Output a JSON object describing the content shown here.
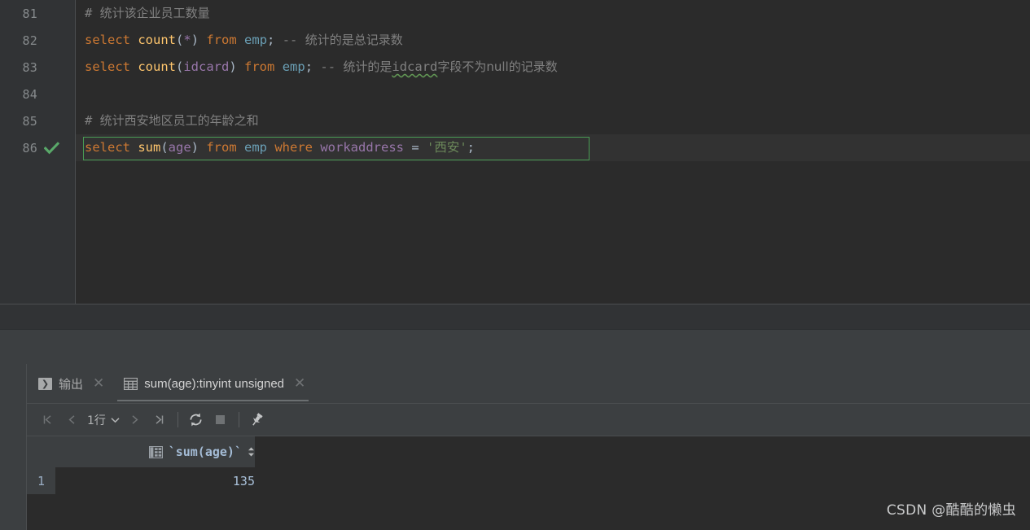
{
  "editor": {
    "lines": [
      {
        "number": "81",
        "has_check": false,
        "selected": false,
        "segments": [
          {
            "text": "# ",
            "type": "comment"
          },
          {
            "text": "统计该企业员工数量",
            "type": "comment-zh"
          }
        ]
      },
      {
        "number": "82",
        "has_check": false,
        "selected": false,
        "segments": [
          {
            "text": "select ",
            "type": "keyword"
          },
          {
            "text": "count",
            "type": "function"
          },
          {
            "text": "(",
            "type": "punct"
          },
          {
            "text": "*",
            "type": "ident"
          },
          {
            "text": ") ",
            "type": "punct"
          },
          {
            "text": "from ",
            "type": "keyword"
          },
          {
            "text": "emp",
            "type": "table"
          },
          {
            "text": "; ",
            "type": "punct"
          },
          {
            "text": "-- ",
            "type": "comment"
          },
          {
            "text": "统计的是总记录数",
            "type": "comment-zh"
          }
        ]
      },
      {
        "number": "83",
        "has_check": false,
        "selected": false,
        "segments": [
          {
            "text": "select ",
            "type": "keyword"
          },
          {
            "text": "count",
            "type": "function"
          },
          {
            "text": "(",
            "type": "punct"
          },
          {
            "text": "idcard",
            "type": "ident"
          },
          {
            "text": ") ",
            "type": "punct"
          },
          {
            "text": "from ",
            "type": "keyword"
          },
          {
            "text": "emp",
            "type": "table"
          },
          {
            "text": "; ",
            "type": "punct"
          },
          {
            "text": "-- ",
            "type": "comment"
          },
          {
            "text": "统计的是",
            "type": "comment-zh"
          },
          {
            "text": "idcard",
            "type": "comment-squiggle"
          },
          {
            "text": "字段不为null的记录数",
            "type": "comment-zh"
          }
        ]
      },
      {
        "number": "84",
        "has_check": false,
        "selected": false,
        "segments": []
      },
      {
        "number": "85",
        "has_check": false,
        "selected": false,
        "segments": [
          {
            "text": "# ",
            "type": "comment"
          },
          {
            "text": "统计西安地区员工的年龄之和",
            "type": "comment-zh"
          }
        ]
      },
      {
        "number": "86",
        "has_check": true,
        "selected": true,
        "segments": [
          {
            "text": "select ",
            "type": "keyword"
          },
          {
            "text": "sum",
            "type": "function"
          },
          {
            "text": "(",
            "type": "punct"
          },
          {
            "text": "age",
            "type": "ident"
          },
          {
            "text": ") ",
            "type": "punct"
          },
          {
            "text": "from ",
            "type": "keyword"
          },
          {
            "text": "emp ",
            "type": "table"
          },
          {
            "text": "where ",
            "type": "keyword"
          },
          {
            "text": "workaddress",
            "type": "ident"
          },
          {
            "text": " = ",
            "type": "op"
          },
          {
            "text": "'西安'",
            "type": "string"
          },
          {
            "text": ";",
            "type": "punct"
          }
        ]
      }
    ]
  },
  "tool_window": {
    "tabs": [
      {
        "label": "输出",
        "icon": "console-icon",
        "active": false,
        "close_label": "✕"
      },
      {
        "label": "sum(age):tinyint unsigned",
        "icon": "grid-icon",
        "active": true,
        "close_label": "✕"
      }
    ],
    "toolbar": {
      "first_page_label": "|<",
      "prev_page_label": "<",
      "row_count_label": "1行",
      "dropdown_label": "⌄",
      "next_page_label": ">",
      "last_page_label": ">|",
      "refresh_label": "refresh-icon",
      "stop_label": "stop-icon",
      "pin_label": "pin-icon"
    },
    "grid": {
      "columns": [
        {
          "name": "`sum(age)`",
          "sortable": true
        }
      ],
      "rows": [
        {
          "index": "1",
          "values": [
            "135"
          ]
        }
      ]
    }
  },
  "watermark": {
    "text": "CSDN @酷酷的懒虫"
  },
  "colors": {
    "editor_background": "#2b2b2b",
    "gutter_background": "#313335",
    "panel_background": "#3c3f41",
    "keyword": "#cc7832",
    "function": "#ffc66d",
    "identifier": "#9876aa",
    "table_ref": "#6a9fb5",
    "comment": "#808080",
    "string": "#6a8759",
    "selection_border": "#499c54",
    "check_green": "#59a869",
    "grid_value": "#a9c1da"
  }
}
